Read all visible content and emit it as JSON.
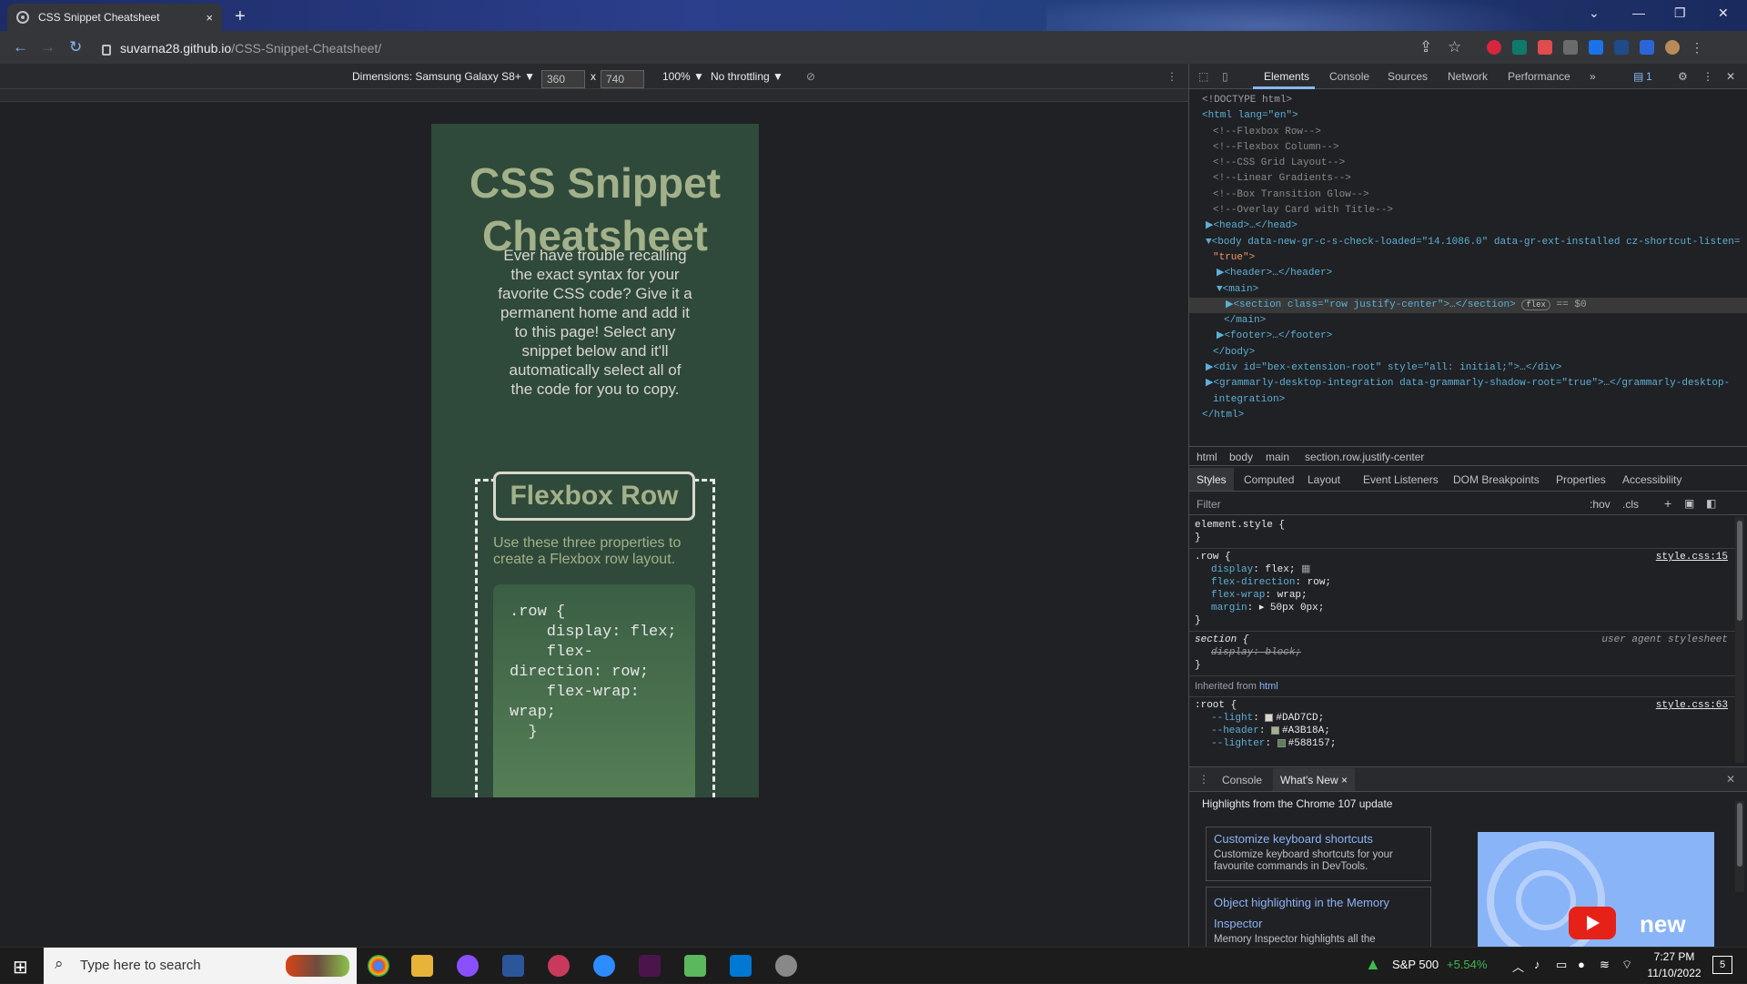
{
  "browser": {
    "tab_title": "CSS Snippet Cheatsheet",
    "tab_close": "×",
    "new_tab": "+",
    "url_host": "suvarna28.github.io",
    "url_path": "/CSS-Snippet-Cheatsheet/"
  },
  "device_toolbar": {
    "dimensions_label": "Dimensions: Samsung Galaxy S8+ ▼",
    "width": "360",
    "times": "x",
    "height": "740",
    "zoom": "100% ▼",
    "throttling": "No throttling ▼"
  },
  "page": {
    "title": "CSS Snippet Cheatsheet",
    "intro": "Ever have trouble recalling the exact syntax for your favorite CSS code? Give it a permanent home and add it to this page! Select any snippet below and it'll automatically select all of the code for you to copy.",
    "card_title": "Flexbox Row",
    "card_description": "Use these three properties to create a Flexbox row layout.",
    "card_code": ".row {\n    display: flex;\n    flex-\ndirection: row;\n    flex-wrap:\nwrap;\n  }"
  },
  "devtools": {
    "tabs": [
      "Elements",
      "Console",
      "Sources",
      "Network",
      "Performance",
      "»"
    ],
    "issues_badge": "1",
    "dom_lines": [
      "<!DOCTYPE html>",
      "<html lang=\"en\">",
      "<!--Flexbox Row-->",
      "<!--Flexbox Column-->",
      "<!--CSS Grid Layout-->",
      "<!--Linear Gradients-->",
      "<!--Box Transition Glow-->",
      "<!--Overlay Card with Title-->",
      "▶<head>…</head>",
      "▼<body data-new-gr-c-s-check-loaded=\"14.1086.0\" data-gr-ext-installed cz-shortcut-listen=",
      "\"true\">",
      "▶<header>…</header>",
      "▼<main>",
      "▶<section class=\"row justify-center\">…</section>",
      "</main>",
      "▶<footer>…</footer>",
      "</body>",
      "▶<div id=\"bex-extension-root\" style=\"all: initial;\">…</div>",
      "▶<grammarly-desktop-integration data-grammarly-shadow-root=\"true\">…</grammarly-desktop-",
      "integration>",
      "</html>"
    ],
    "flex_badge": "flex",
    "eq_sel": "== $0",
    "breadcrumbs": [
      "html",
      "body",
      "main",
      "section.row.justify-center"
    ],
    "style_tabs": [
      "Styles",
      "Computed",
      "Layout",
      "Event Listeners",
      "DOM Breakpoints",
      "Properties",
      "Accessibility"
    ],
    "filter_placeholder": "Filter",
    "hov": ":hov",
    "cls": ".cls",
    "styles": {
      "element_style": "element.style {",
      "close": "}",
      "row_selector": ".row {",
      "row_src": "style.css:15",
      "row_props": [
        [
          "display",
          "flex;"
        ],
        [
          "flex-direction",
          "row;"
        ],
        [
          "flex-wrap",
          "wrap;"
        ],
        [
          "margin",
          "▸ 50px 0px;"
        ]
      ],
      "section_selector": "section {",
      "section_src": "user agent stylesheet",
      "section_prop": "display: block;",
      "inherited": "Inherited from",
      "inherited_tag": "html",
      "root_selector": ":root {",
      "root_src": "style.css:63",
      "root_vars": [
        [
          "--light",
          "#DAD7CD",
          "#dad7cd"
        ],
        [
          "--header",
          "#A3B18A",
          "#a3b18a"
        ],
        [
          "--lighter",
          "#588157",
          "#588157"
        ]
      ]
    },
    "drawer_tabs": [
      "Console",
      "What's New ×"
    ],
    "drawer_heading": "Highlights from the Chrome 107 update",
    "drawer_items": [
      {
        "title": "Customize keyboard shortcuts",
        "desc": "Customize keyboard shortcuts for your favourite commands in DevTools."
      },
      {
        "title": "Object highlighting in the Memory Inspector",
        "desc": "Memory Inspector highlights all the"
      }
    ],
    "video_label": "new"
  },
  "taskbar": {
    "search_placeholder": "Type here to search",
    "stock": "S&P 500",
    "stock_change": "+5.54%",
    "time": "7:27 PM",
    "date": "11/10/2022",
    "notif_count": "5"
  }
}
